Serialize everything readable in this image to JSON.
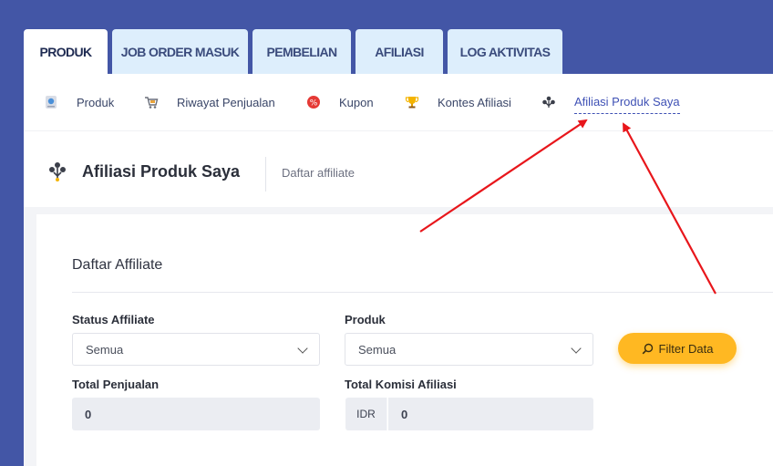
{
  "tabs": [
    {
      "label": "PRODUK",
      "active": true
    },
    {
      "label": "JOB ORDER MASUK",
      "active": false
    },
    {
      "label": "PEMBELIAN",
      "active": false
    },
    {
      "label": "AFILIASI",
      "active": false
    },
    {
      "label": "LOG AKTIVITAS",
      "active": false
    }
  ],
  "subnav": [
    {
      "label": "Produk",
      "icon": "product-icon"
    },
    {
      "label": "Riwayat Penjualan",
      "icon": "cart-icon"
    },
    {
      "label": "Kupon",
      "icon": "coupon-icon"
    },
    {
      "label": "Kontes Afiliasi",
      "icon": "trophy-icon"
    },
    {
      "label": "Afiliasi Produk Saya",
      "icon": "affiliate-icon",
      "active": true
    }
  ],
  "header": {
    "title": "Afiliasi Produk Saya",
    "subtitle": "Daftar affiliate"
  },
  "card": {
    "title": "Daftar Affiliate",
    "status": {
      "label": "Status Affiliate",
      "value": "Semua"
    },
    "produk": {
      "label": "Produk",
      "value": "Semua"
    },
    "filter_button": "Filter Data",
    "total_penjualan": {
      "label": "Total Penjualan",
      "value": "0"
    },
    "total_komisi": {
      "label": "Total Komisi Afiliasi",
      "currency": "IDR",
      "value": "0"
    }
  },
  "colors": {
    "background": "#4356a6",
    "accent": "#3f51b5",
    "button": "#ffb822",
    "arrow": "#e8161b"
  }
}
